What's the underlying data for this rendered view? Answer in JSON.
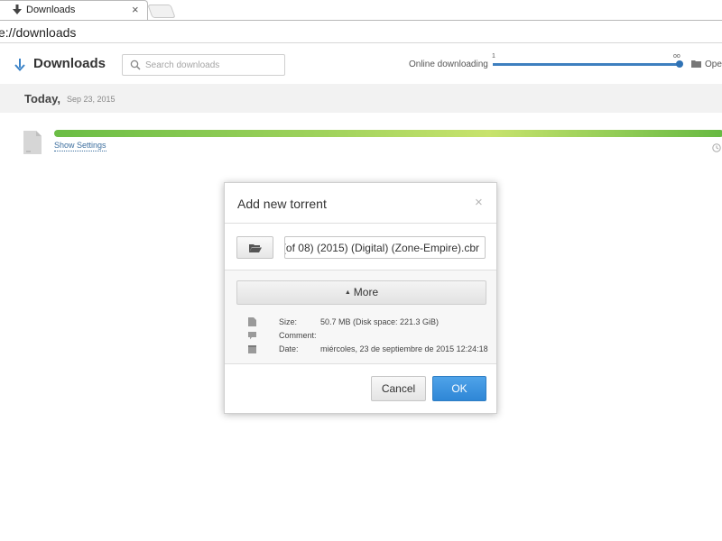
{
  "browser": {
    "tab": {
      "title": "Downloads",
      "close_glyph": "×",
      "icon": "download-arrow-icon"
    },
    "address_bar": {
      "url": "e://downloads"
    }
  },
  "header": {
    "title": "Downloads",
    "search": {
      "placeholder": "Search downloads",
      "value": ""
    },
    "online_downloading": {
      "label": "Online downloading",
      "min_label": "1",
      "max_label": "oo",
      "level": 1.0
    },
    "open_folder": {
      "label": "Ope"
    }
  },
  "date_group": {
    "label": "Today,",
    "date": "Sep 23, 2015"
  },
  "download_item": {
    "progress_fraction": 1.0,
    "show_settings_label": "Show Settings"
  },
  "dialog": {
    "title": "Add new torrent",
    "close_glyph": "×",
    "filename": "(of 08) (2015) (Digital) (Zone-Empire).cbr",
    "more_button": {
      "caret": "▲",
      "label": "More"
    },
    "info": [
      {
        "icon": "file-icon",
        "key": "Size:",
        "value": "50.7 MB (Disk space: 221.3 GiB)"
      },
      {
        "icon": "comment-icon",
        "key": "Comment:",
        "value": ""
      },
      {
        "icon": "calendar-icon",
        "key": "Date:",
        "value": "miércoles, 23 de septiembre de 2015 12:24:18"
      }
    ],
    "cancel_label": "Cancel",
    "ok_label": "OK"
  },
  "colors": {
    "accent_blue": "#2e86d6",
    "progress_green": "#6bbd45",
    "link_blue": "#3c6e9e"
  }
}
